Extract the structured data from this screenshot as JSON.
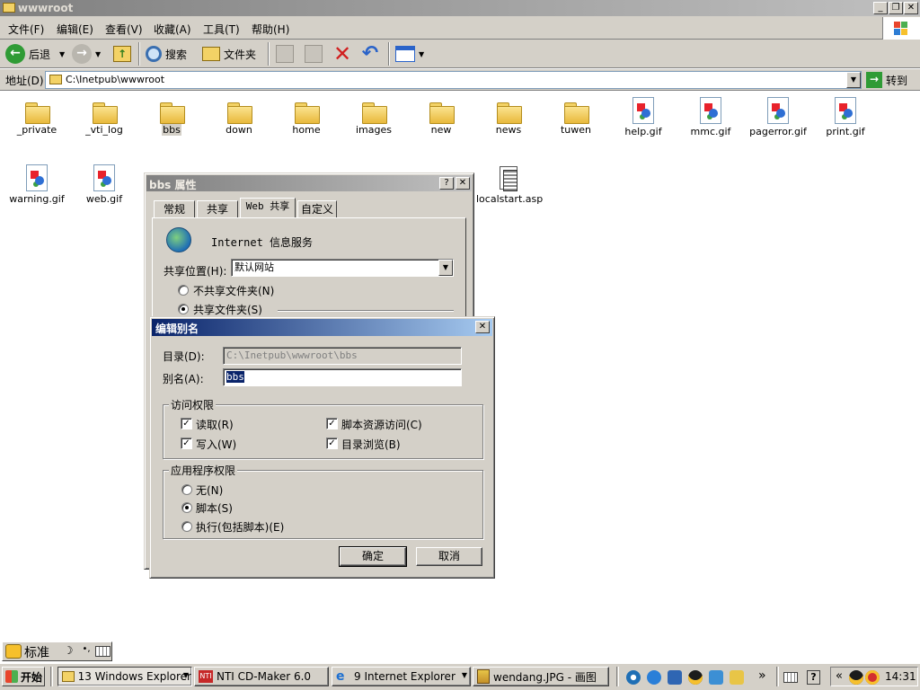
{
  "window": {
    "title": "wwwroot"
  },
  "menu": [
    "文件(F)",
    "编辑(E)",
    "查看(V)",
    "收藏(A)",
    "工具(T)",
    "帮助(H)"
  ],
  "toolbar": {
    "back": "后退",
    "search": "搜索",
    "folders": "文件夹"
  },
  "address": {
    "label": "地址(D)",
    "value": "C:\\Inetpub\\wwwroot",
    "go": "转到"
  },
  "files_row1": [
    {
      "name": "_private",
      "type": "folder"
    },
    {
      "name": "_vti_log",
      "type": "folder"
    },
    {
      "name": "bbs",
      "type": "folder"
    },
    {
      "name": "down",
      "type": "folder"
    },
    {
      "name": "home",
      "type": "folder"
    },
    {
      "name": "images",
      "type": "folder"
    },
    {
      "name": "new",
      "type": "folder"
    },
    {
      "name": "news",
      "type": "folder"
    },
    {
      "name": "tuwen",
      "type": "folder"
    },
    {
      "name": "help.gif",
      "type": "gif"
    },
    {
      "name": "mmc.gif",
      "type": "gif"
    },
    {
      "name": "pagerror.gif",
      "type": "gif"
    },
    {
      "name": "print.gif",
      "type": "gif"
    }
  ],
  "files_row2": [
    {
      "name": "warning.gif",
      "type": "gif"
    },
    {
      "name": "web.gif",
      "type": "gif"
    },
    {
      "name": "localstart.asp",
      "type": "asp"
    }
  ],
  "props": {
    "title": "bbs 属性",
    "tabs": [
      "常规",
      "共享",
      "Web 共享",
      "自定义"
    ],
    "service": "Internet 信息服务",
    "share_label": "共享位置(H):",
    "share_value": "默认网站",
    "no_share": "不共享文件夹(N)",
    "share": "共享文件夹(S)"
  },
  "alias": {
    "title": "编辑别名",
    "dir_label": "目录(D):",
    "dir_value": "C:\\Inetpub\\wwwroot\\bbs",
    "alias_label": "别名(A):",
    "alias_value": "bbs",
    "access_title": "访问权限",
    "read": "读取(R)",
    "write": "写入(W)",
    "script_access": "脚本资源访问(C)",
    "dir_browse": "目录浏览(B)",
    "app_title": "应用程序权限",
    "none": "无(N)",
    "scripts": "脚本(S)",
    "execute": "执行(包括脚本)(E)",
    "ok": "确定",
    "cancel": "取消"
  },
  "ime": {
    "mode": "标准"
  },
  "taskbar": {
    "start": "开始",
    "tasks": [
      "13 Windows Explorer",
      "NTI CD-Maker 6.0",
      "9 Internet Explorer",
      "wendang.JPG - 画图"
    ],
    "time": "14:31"
  }
}
